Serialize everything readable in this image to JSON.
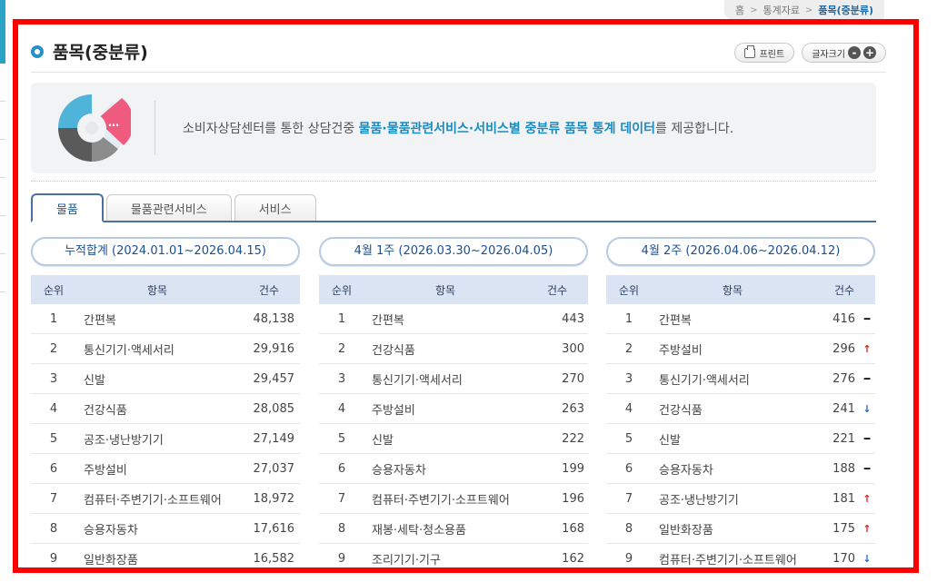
{
  "breadcrumb": {
    "home": "홈",
    "section": "통계자료",
    "current": "품목(중분류)"
  },
  "page_title": "품목(중분류)",
  "tools": {
    "print": "프린트",
    "font_size": "글자크기",
    "zoom_out": "-",
    "zoom_in": "+"
  },
  "intro": {
    "text_before": "소비자상담센터를 통한 상담건중 ",
    "highlight": "물품·물품관련서비스·서비스별 중분류 품목 통계 데이터",
    "text_after": "를 제공합니다."
  },
  "tabs": [
    {
      "label": "물품"
    },
    {
      "label": "물품관련서비스"
    },
    {
      "label": "서비스"
    }
  ],
  "table_headers": {
    "rank": "순위",
    "item": "항목",
    "count": "건수"
  },
  "colors": {
    "accent": "#4a6fa0",
    "highlight": "#1a8cc0",
    "up": "#e0201c",
    "down": "#2469c8",
    "frame": "#ff0000"
  },
  "columns": [
    {
      "period": "누적합계 (2024.01.01~2026.04.15)",
      "rows": [
        {
          "rank": "1",
          "item": "간편복",
          "count": "48,138"
        },
        {
          "rank": "2",
          "item": "통신기기·액세서리",
          "count": "29,916"
        },
        {
          "rank": "3",
          "item": "신발",
          "count": "29,457"
        },
        {
          "rank": "4",
          "item": "건강식품",
          "count": "28,085"
        },
        {
          "rank": "5",
          "item": "공조·냉난방기기",
          "count": "27,149"
        },
        {
          "rank": "6",
          "item": "주방설비",
          "count": "27,037"
        },
        {
          "rank": "7",
          "item": "컴퓨터·주변기기·소프트웨어",
          "count": "18,972"
        },
        {
          "rank": "8",
          "item": "승용자동차",
          "count": "17,616"
        },
        {
          "rank": "9",
          "item": "일반화장품",
          "count": "16,582"
        }
      ]
    },
    {
      "period": "4월 1주 (2026.03.30~2026.04.05)",
      "rows": [
        {
          "rank": "1",
          "item": "간편복",
          "count": "443"
        },
        {
          "rank": "2",
          "item": "건강식품",
          "count": "300"
        },
        {
          "rank": "3",
          "item": "통신기기·액세서리",
          "count": "270"
        },
        {
          "rank": "4",
          "item": "주방설비",
          "count": "263"
        },
        {
          "rank": "5",
          "item": "신발",
          "count": "222"
        },
        {
          "rank": "6",
          "item": "승용자동차",
          "count": "199"
        },
        {
          "rank": "7",
          "item": "컴퓨터·주변기기·소프트웨어",
          "count": "196"
        },
        {
          "rank": "8",
          "item": "재봉·세탁·청소용품",
          "count": "168"
        },
        {
          "rank": "9",
          "item": "조리기기·기구",
          "count": "162"
        }
      ]
    },
    {
      "period": "4월 2주 (2026.04.06~2026.04.12)",
      "rows": [
        {
          "rank": "1",
          "item": "간편복",
          "count": "416",
          "trend": "same",
          "trend_icon": "dash-icon"
        },
        {
          "rank": "2",
          "item": "주방설비",
          "count": "296",
          "trend": "up",
          "trend_icon": "arrow-up-icon"
        },
        {
          "rank": "3",
          "item": "통신기기·액세서리",
          "count": "276",
          "trend": "same",
          "trend_icon": "dash-icon"
        },
        {
          "rank": "4",
          "item": "건강식품",
          "count": "241",
          "trend": "down",
          "trend_icon": "arrow-down-icon"
        },
        {
          "rank": "5",
          "item": "신발",
          "count": "221",
          "trend": "same",
          "trend_icon": "dash-icon"
        },
        {
          "rank": "6",
          "item": "승용자동차",
          "count": "188",
          "trend": "same",
          "trend_icon": "dash-icon"
        },
        {
          "rank": "7",
          "item": "공조·냉난방기기",
          "count": "181",
          "trend": "up",
          "trend_icon": "arrow-up-icon"
        },
        {
          "rank": "8",
          "item": "일반화장품",
          "count": "175",
          "trend": "up",
          "trend_icon": "arrow-up-icon"
        },
        {
          "rank": "9",
          "item": "컴퓨터·주변기기·소프트웨어",
          "count": "170",
          "trend": "down",
          "trend_icon": "arrow-down-icon"
        }
      ]
    }
  ]
}
